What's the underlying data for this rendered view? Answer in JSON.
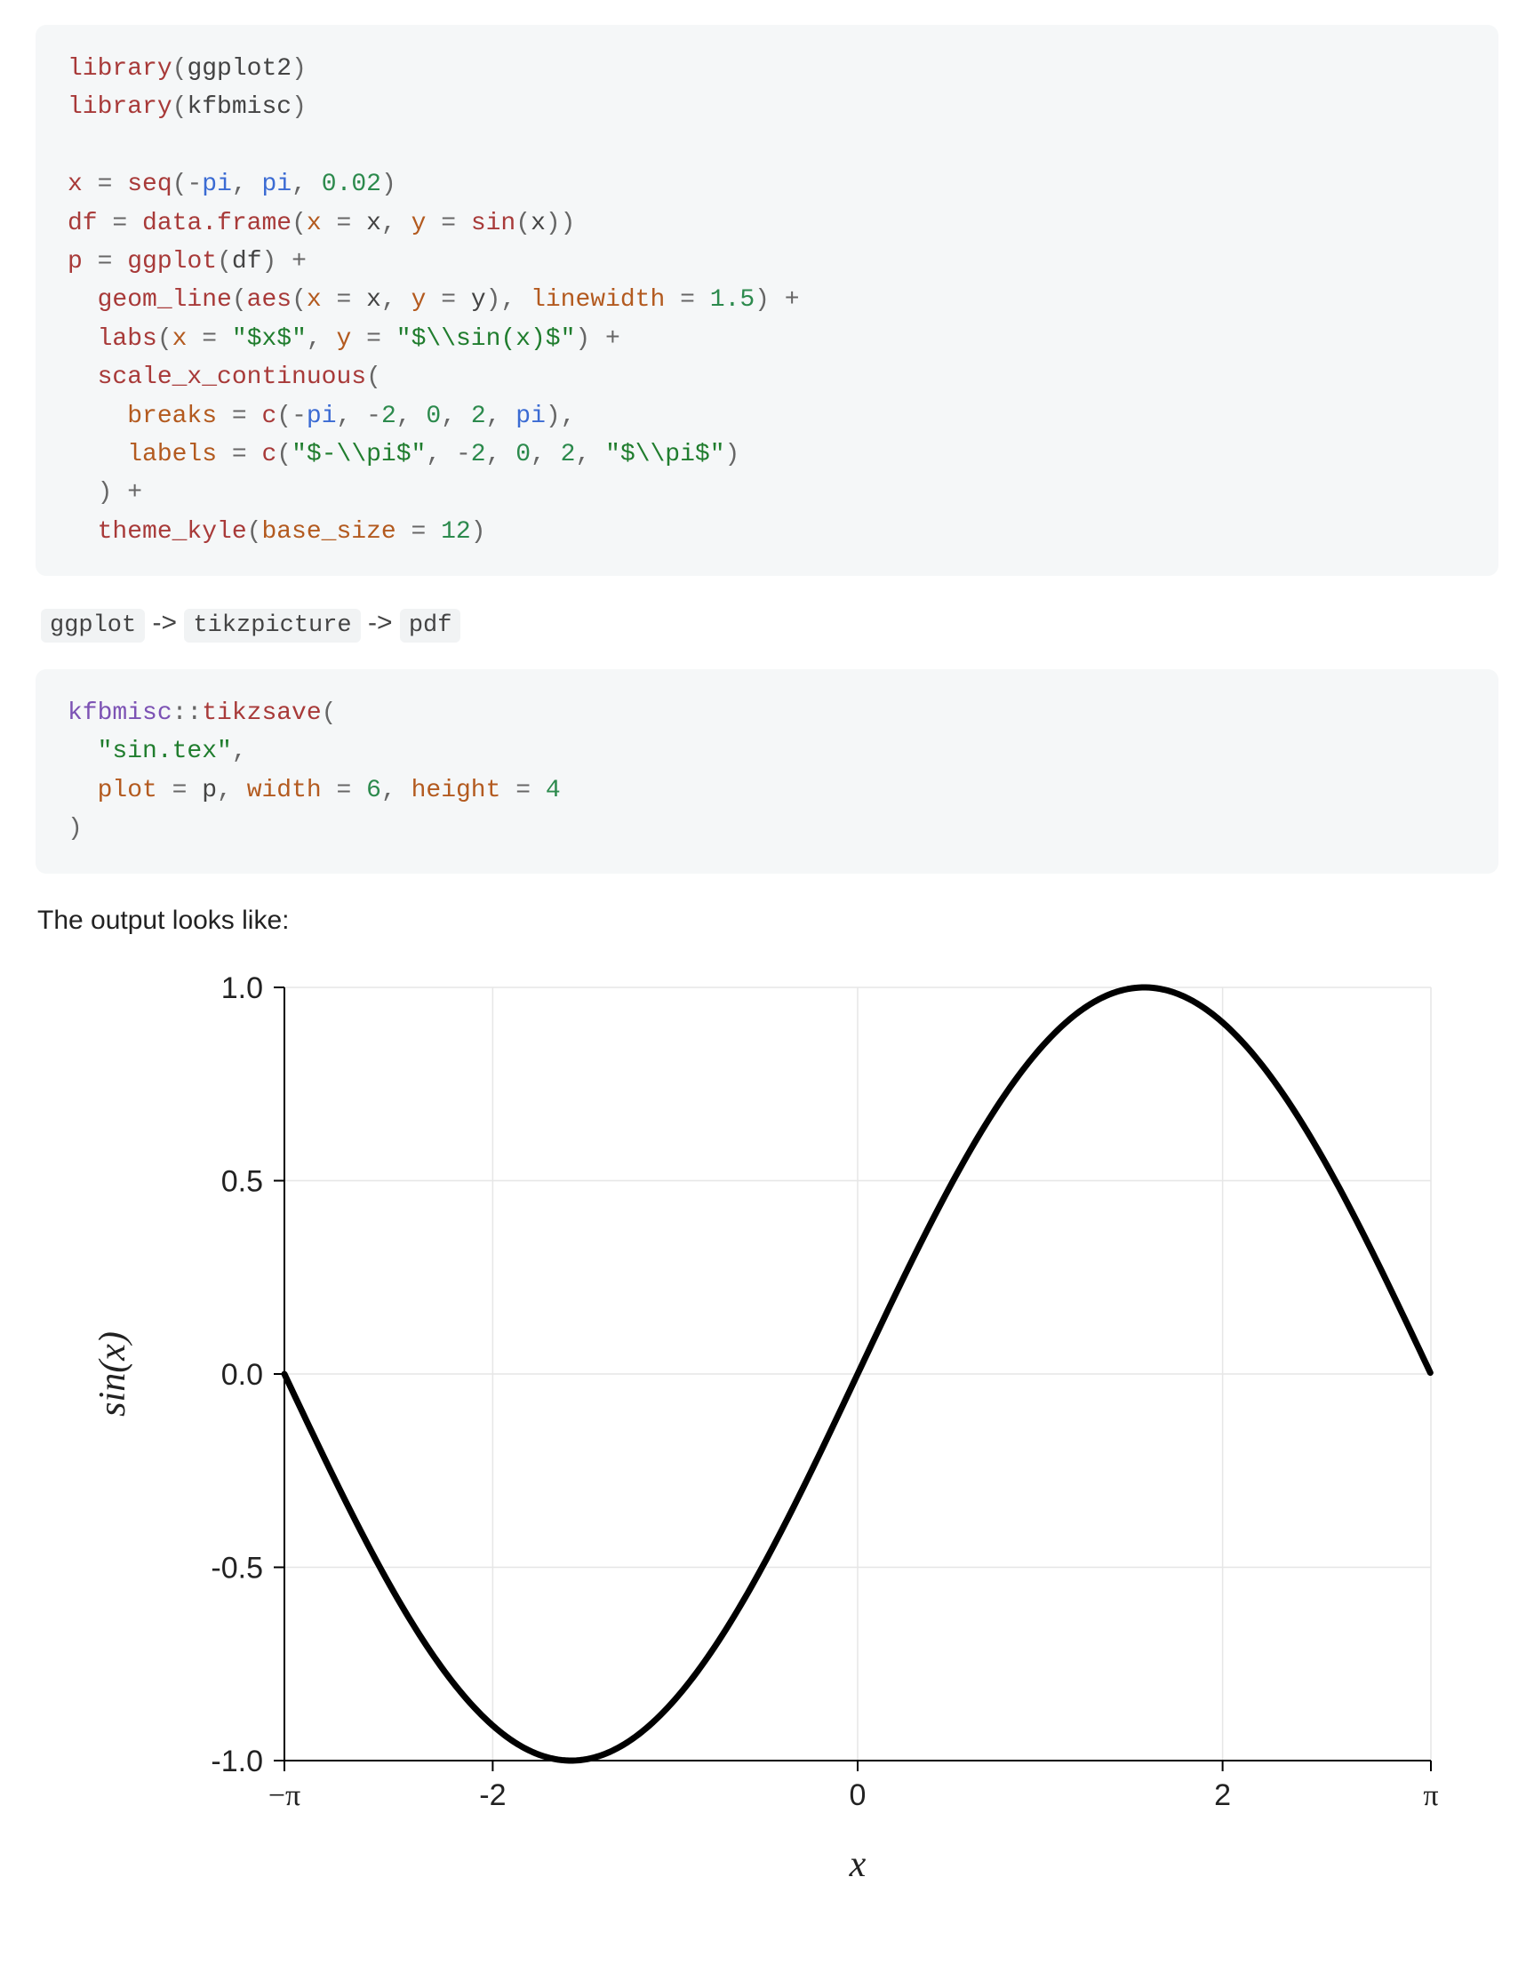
{
  "code1": {
    "raw": "library(ggplot2)\nlibrary(kfbmisc)\n\nx = seq(-pi, pi, 0.02)\ndf = data.frame(x = x, y = sin(x))\np = ggplot(df) +\n  geom_line(aes(x = x, y = y), linewidth = 1.5) +\n  labs(x = \"$x$\", y = \"$\\\\sin(x)$\") +\n  scale_x_continuous(\n    breaks = c(-pi, -2, 0, 2, pi),\n    labels = c(\"$-\\\\pi$\", -2, 0, 2, \"$\\\\pi$\")\n  ) +\n  theme_kyle(base_size = 12)"
  },
  "flow": {
    "item1": "ggplot",
    "arrow1": " -> ",
    "item2": "tikzpicture",
    "arrow2": " -> ",
    "item3": "pdf"
  },
  "code2": {
    "raw": "kfbmisc::tikzsave(\n  \"sin.tex\",\n  plot = p, width = 6, height = 4\n)"
  },
  "caption": "The output looks like:",
  "chart_data": {
    "type": "line",
    "title": "",
    "xlabel": "x",
    "ylabel": "sin(x)",
    "xlim": [
      -3.14159265,
      3.14159265
    ],
    "ylim": [
      -1.0,
      1.0
    ],
    "x_breaks": [
      -3.14159265,
      -2,
      0,
      2,
      3.14159265
    ],
    "x_tick_labels": [
      "−π",
      "-2",
      "0",
      "2",
      "π"
    ],
    "y_breaks": [
      -1.0,
      -0.5,
      0.0,
      0.5,
      1.0
    ],
    "y_tick_labels": [
      "-1.0",
      "-0.5",
      "0.0",
      "0.5",
      "1.0"
    ],
    "series": [
      {
        "name": "sin(x)",
        "function": "sin",
        "x_from": -3.14159265,
        "x_to": 3.14159265,
        "step": 0.02
      }
    ],
    "grid": true
  }
}
